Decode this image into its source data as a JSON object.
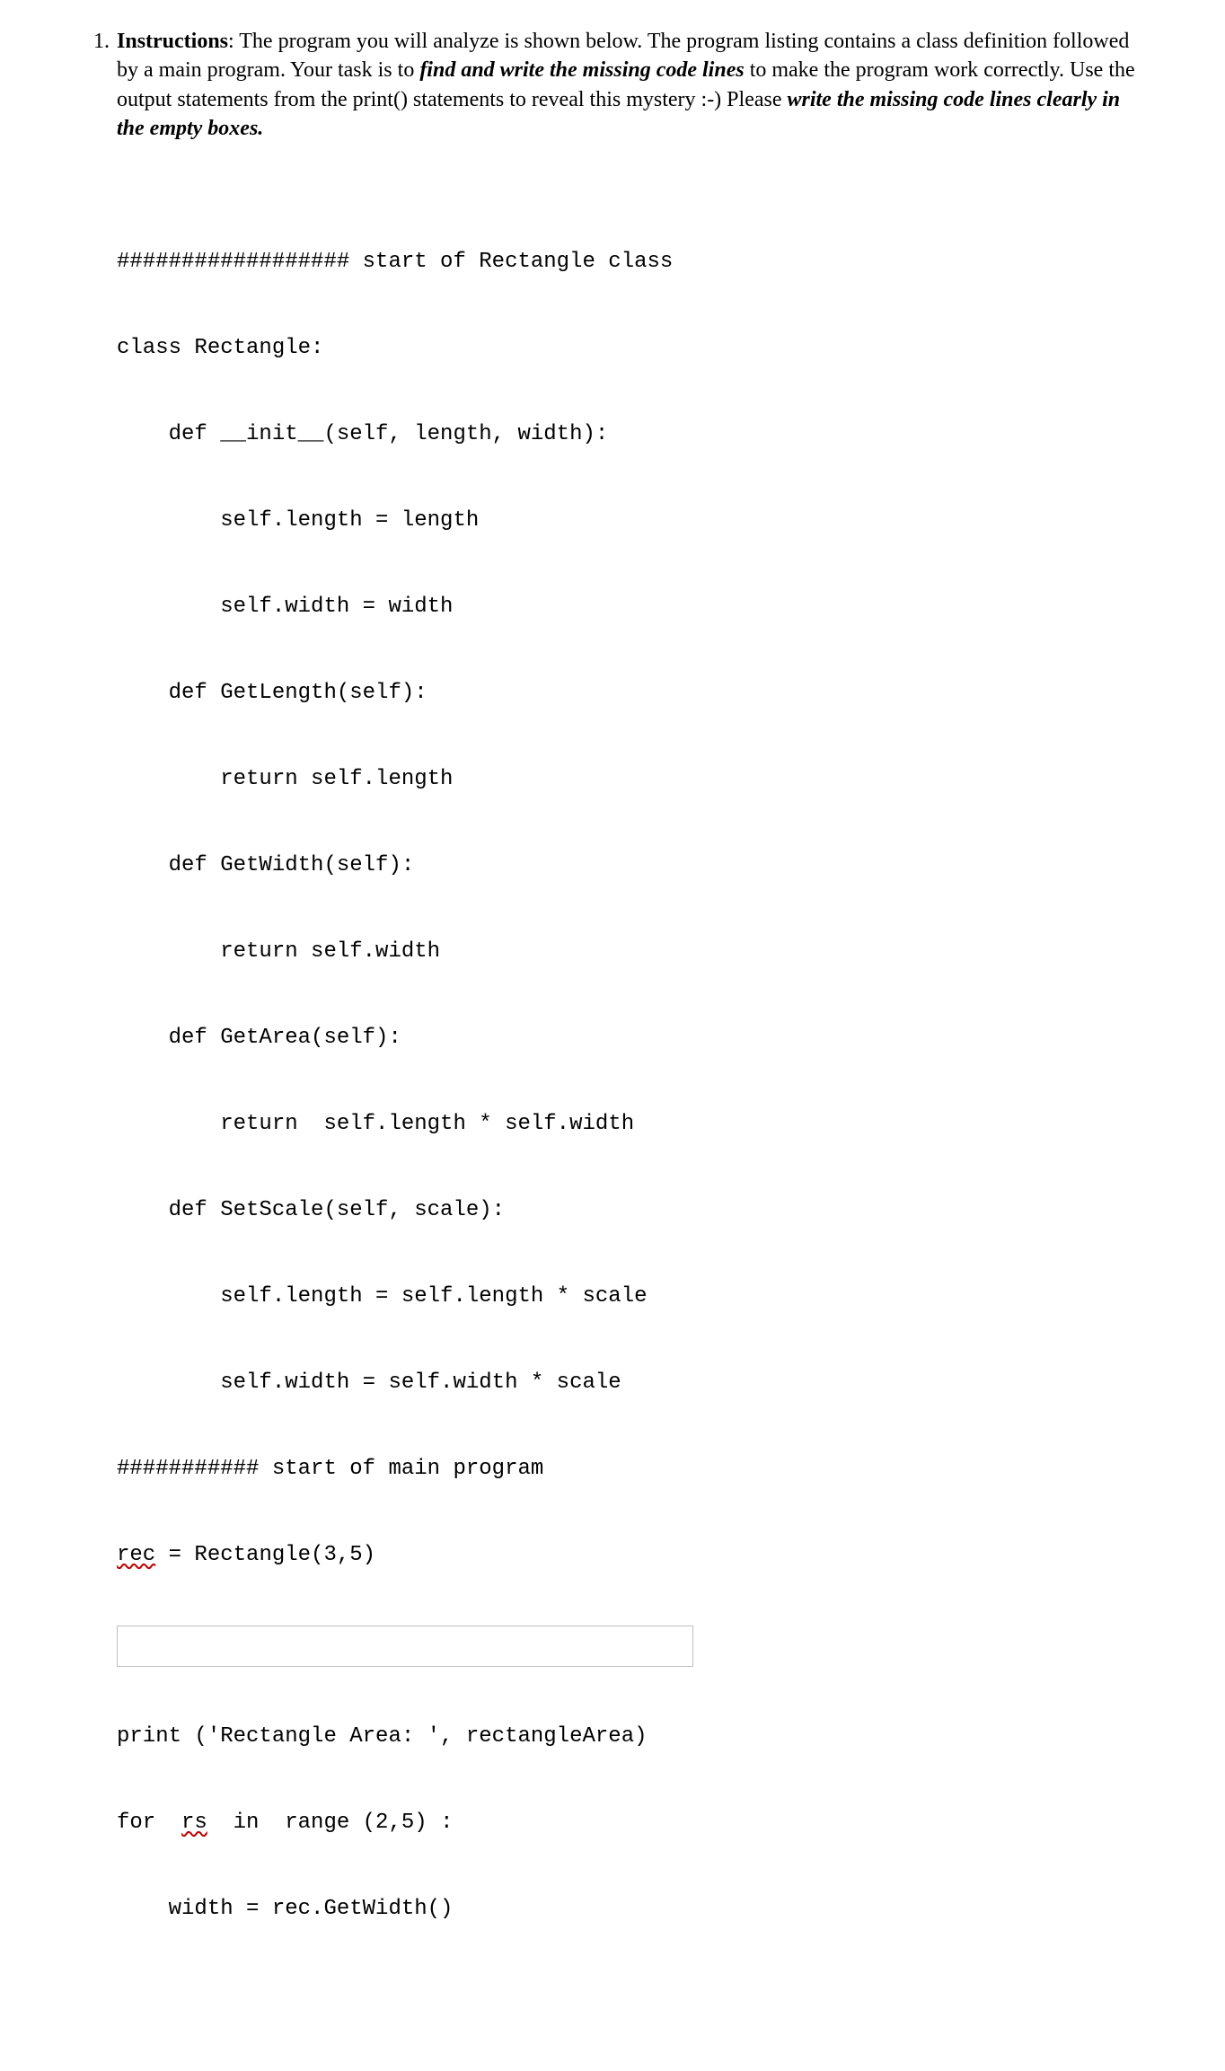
{
  "question": {
    "number": "1.",
    "label": "Instructions",
    "sep": ":  ",
    "text_1": "The program you will analyze is shown below. The program listing contains a class definition followed by a main program. Your task is to ",
    "emph_1": "find and write the missing code lines",
    "text_2": " to make the program work correctly. Use the output statements from the print() statements to reveal this mystery :-)  Please ",
    "emph_2": "write the missing code lines clearly in the empty boxes."
  },
  "code": {
    "l01": "################## start of Rectangle class",
    "l02": "class Rectangle:",
    "l03": "    def __init__(self, length, width):",
    "l04": "        self.length = length",
    "l05": "        self.width = width",
    "l06": "    def GetLength(self):",
    "l07": "        return self.length",
    "l08": "    def GetWidth(self):",
    "l09": "        return self.width",
    "l10": "    def GetArea(self):",
    "l11": "        return  self.length * self.width",
    "l12": "    def SetScale(self, scale):",
    "l13": "        self.length = self.length * scale",
    "l14": "        self.width = self.width * scale",
    "l15": "########### start of main program",
    "l16a": "rec",
    "l16b": " = Rectangle(3,5)",
    "l18": "print ('Rectangle Area: ', rectangleArea)",
    "l19a": "for  ",
    "l19b": "rs",
    "l19c": "  in  range (2,5) :",
    "l20": "    width = rec.GetWidth()"
  }
}
